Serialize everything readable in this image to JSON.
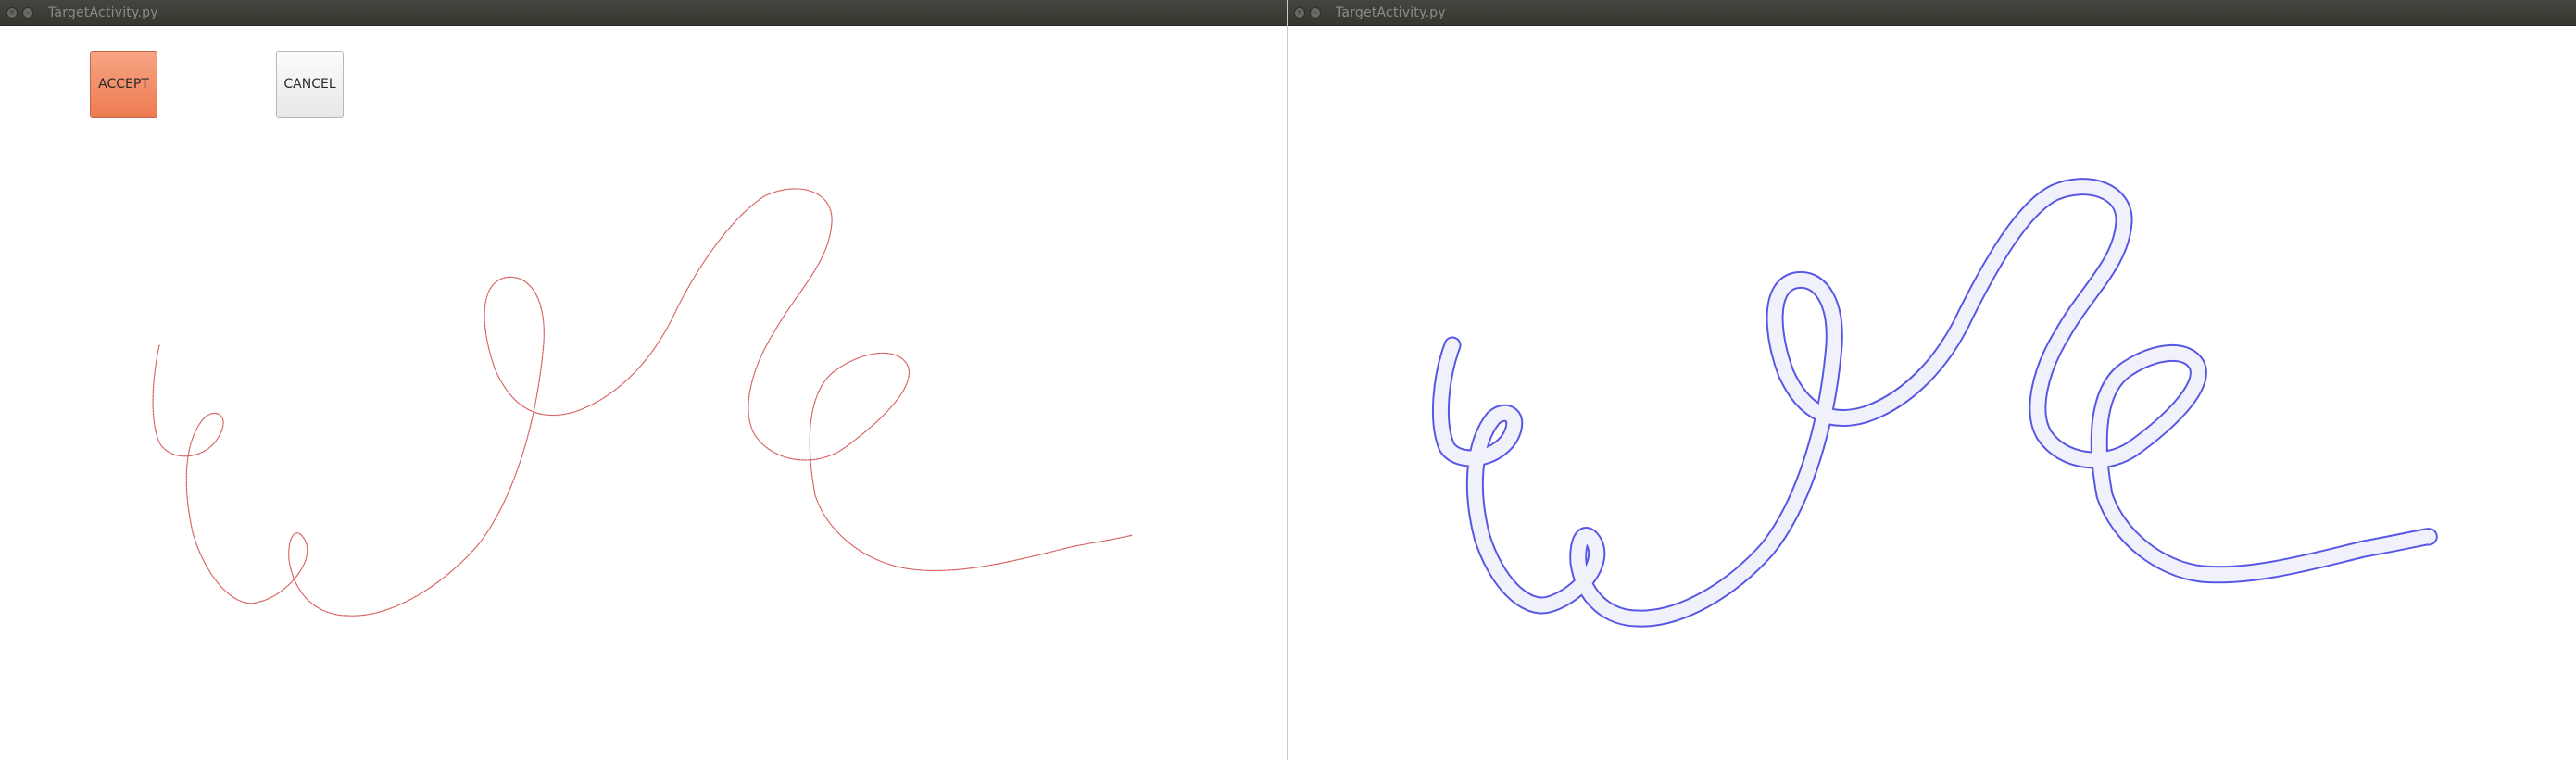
{
  "windows": [
    {
      "title": "TargetActivity.py",
      "buttons": {
        "accept_label": "ACCEPT",
        "cancel_label": "CANCEL"
      },
      "stroke_color": "#d46060"
    },
    {
      "title": "TargetActivity.py",
      "stroke_color": "#3a3ae0"
    }
  ],
  "icons": {
    "close": "close-icon",
    "minimize": "minimize-icon"
  },
  "colors": {
    "titlebar": "#3c3b37",
    "accept_button": "#f28c63",
    "cancel_button": "#f0f0f0",
    "divider": "#c9c9c9"
  }
}
